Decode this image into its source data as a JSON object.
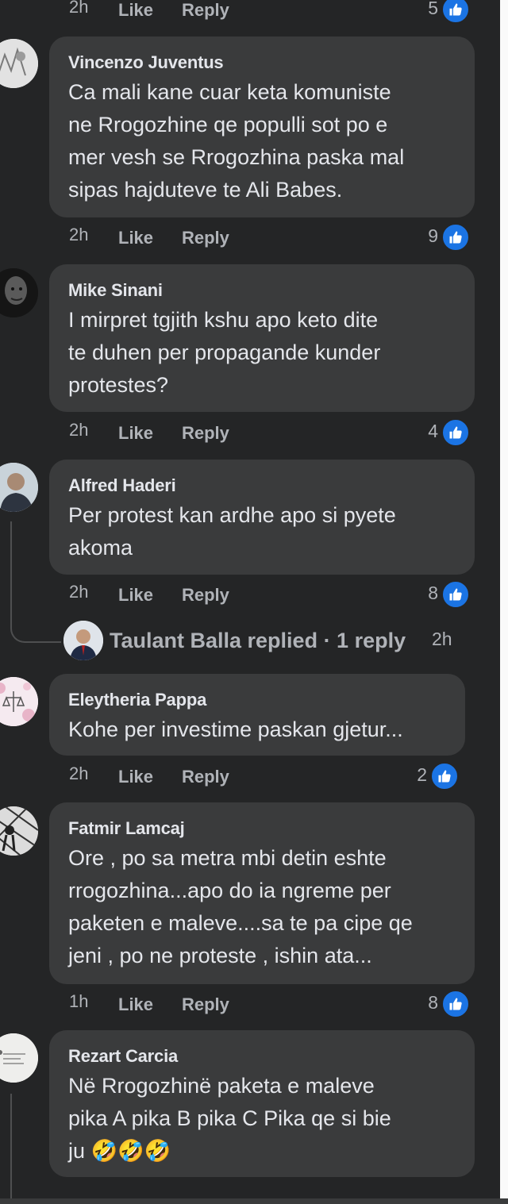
{
  "top_meta": {
    "time": "2h",
    "like": "Like",
    "reply": "Reply",
    "reaction_count": "5"
  },
  "comments": [
    {
      "author": "Vincenzo Juventus",
      "lines": [
        "Ca mali kane cuar keta komuniste",
        "ne Rrogozhine qe populli sot po e",
        "mer vesh se Rrogozhina paska mal",
        "sipas hajduteve te Ali Babes."
      ],
      "time": "2h",
      "like": "Like",
      "reply": "Reply",
      "reaction_count": "9"
    },
    {
      "author": "Mike Sinani",
      "lines": [
        "I mirpret tgjith kshu apo keto dite",
        "te duhen per propagande kunder",
        "protestes?"
      ],
      "time": "2h",
      "like": "Like",
      "reply": "Reply",
      "reaction_count": "4"
    },
    {
      "author": "Alfred Haderi",
      "lines": [
        "Per protest kan ardhe apo si pyete",
        "akoma"
      ],
      "time": "2h",
      "like": "Like",
      "reply": "Reply",
      "reaction_count": "8",
      "replies_link": {
        "text": "Taulant Balla replied · 1 reply",
        "time": "2h"
      }
    },
    {
      "author": "Eleytheria Pappa",
      "lines": [
        "Kohe per investime paskan gjetur..."
      ],
      "time": "2h",
      "like": "Like",
      "reply": "Reply",
      "reaction_count": "2"
    },
    {
      "author": "Fatmir Lamcaj",
      "lines": [
        "Ore , po sa metra mbi detin eshte",
        "rrogozhina...apo do ia ngreme per",
        "paketen e maleve....sa te pa cipe qe",
        "jeni , po ne proteste , ishin ata..."
      ],
      "time": "1h",
      "like": "Like",
      "reply": "Reply",
      "reaction_count": "8"
    },
    {
      "author": "Rezart Carcia",
      "lines": [
        "Në Rrogozhinë paketa e maleve",
        "pika A pika B pika C Pika qe si bie",
        "ju 🤣🤣🤣"
      ]
    }
  ],
  "colors": {
    "background": "#242526",
    "bubble": "#3a3b3c",
    "primary_text": "#e4e6eb",
    "secondary_text": "#b0b3b8",
    "like_blue": "#1b74e4"
  },
  "icons": {
    "reaction": "thumbs-up-icon",
    "laugh": "rolling-on-floor-laughing-emoji"
  }
}
